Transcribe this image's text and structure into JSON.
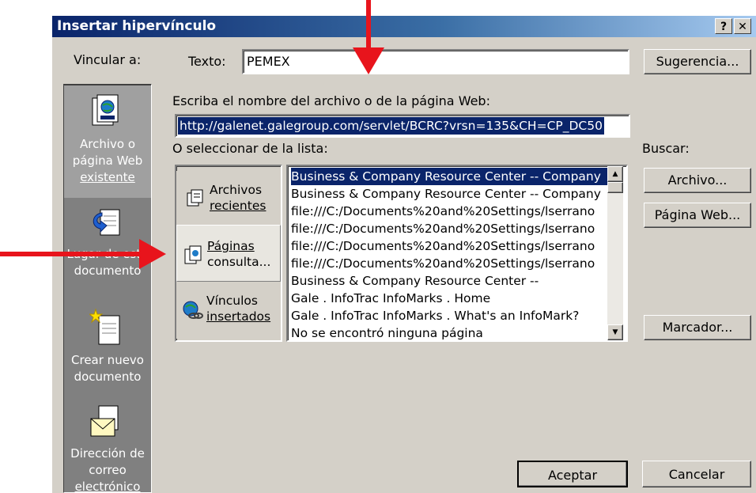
{
  "window": {
    "title": "Insertar hipervínculo",
    "help_label": "?",
    "close_label": "✕"
  },
  "link_to": {
    "label": "Vincular a:",
    "items": [
      {
        "label_lines": [
          "Archivo o",
          "página Web",
          "existente"
        ],
        "icon": "web-page-file-icon"
      },
      {
        "label_lines": [
          "Lugar de este",
          "documento"
        ],
        "icon": "place-in-document-icon"
      },
      {
        "label_lines": [
          "Crear nuevo",
          "documento"
        ],
        "icon": "new-document-icon"
      },
      {
        "label_lines": [
          "Dirección de",
          "correo",
          "electrónico"
        ],
        "icon": "email-envelope-icon"
      }
    ]
  },
  "text_field": {
    "label": "Texto:",
    "value": "PEMEX"
  },
  "suggestion_button": "Sugerencia...",
  "address": {
    "label": "Escriba el nombre del archivo o de la página Web:",
    "value": "http://galenet.galegroup.com/servlet/BCRC?vrsn=135&CH=CP_DC50"
  },
  "list_label": "O seleccionar de la lista:",
  "browse": {
    "label": "Buscar:",
    "file_button": "Archivo...",
    "web_button": "Página Web..."
  },
  "list_tabs": [
    {
      "label_lines": [
        "Archivos",
        "recientes"
      ],
      "icon": "recent-files-icon"
    },
    {
      "label_lines": [
        "Páginas",
        "consulta..."
      ],
      "icon": "browsed-pages-icon"
    },
    {
      "label_lines": [
        "Vínculos",
        "insertados"
      ],
      "icon": "inserted-links-icon"
    }
  ],
  "list_items": [
    "Business & Company Resource Center -- Company",
    "Business & Company Resource Center -- Company",
    "file:///C:/Documents%20and%20Settings/lserrano",
    "file:///C:/Documents%20and%20Settings/lserrano",
    "file:///C:/Documents%20and%20Settings/lserrano",
    "file:///C:/Documents%20and%20Settings/lserrano",
    "Business & Company Resource Center --",
    "Gale . InfoTrac InfoMarks . Home",
    "Gale . InfoTrac InfoMarks . What's an InfoMark?",
    "No se encontró ninguna página"
  ],
  "bookmark_button": "Marcador...",
  "ok_button": "Aceptar",
  "cancel_button": "Cancelar",
  "colors": {
    "title_start": "#0a246a",
    "face": "#d4d0c8",
    "sidebar": "#808080",
    "selection": "#0a246a",
    "annotation_arrow": "#e8141c"
  }
}
